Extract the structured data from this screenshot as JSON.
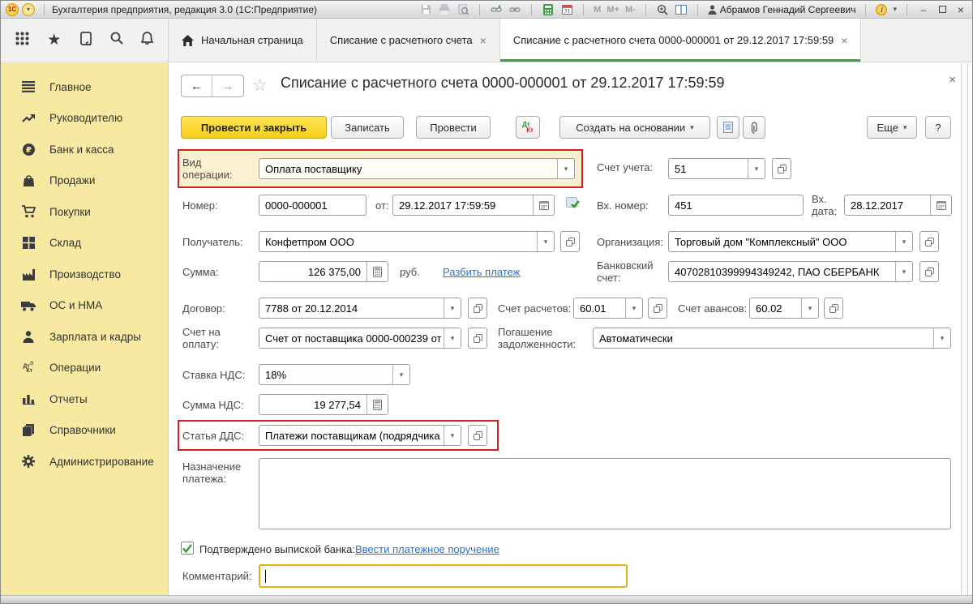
{
  "titlebar": {
    "logo_text": "1С",
    "app_title": "Бухгалтерия предприятия, редакция 3.0  (1С:Предприятие)",
    "user_name": "Абрамов Геннадий Сергеевич",
    "mem": [
      "M",
      "M+",
      "M-"
    ]
  },
  "icons": {
    "dropdown": "▾",
    "close": "×",
    "back_arrow": "←",
    "forward_arrow": "→",
    "star_outline": "☆",
    "help": "?",
    "minimize": "–",
    "info_letter": "i",
    "calendar_day": "31",
    "dt": "Дт",
    "kt": "Кт"
  },
  "tabbar": {
    "tabs": [
      {
        "label": "Начальная страница"
      },
      {
        "label": "Списание с расчетного счета"
      },
      {
        "label": "Списание с расчетного счета 0000-000001 от 29.12.2017 17:59:59"
      }
    ]
  },
  "sidebar": {
    "items": [
      {
        "label": "Главное"
      },
      {
        "label": "Руководителю"
      },
      {
        "label": "Банк и касса"
      },
      {
        "label": "Продажи"
      },
      {
        "label": "Покупки"
      },
      {
        "label": "Склад"
      },
      {
        "label": "Производство"
      },
      {
        "label": "ОС и НМА"
      },
      {
        "label": "Зарплата и кадры"
      },
      {
        "label": "Операции"
      },
      {
        "label": "Отчеты"
      },
      {
        "label": "Справочники"
      },
      {
        "label": "Администрирование"
      }
    ]
  },
  "form": {
    "title": "Списание с расчетного счета 0000-000001 от 29.12.2017 17:59:59",
    "toolbar": {
      "post_and_close": "Провести и закрыть",
      "save": "Записать",
      "post": "Провести",
      "create_based": "Создать на основании",
      "more": "Еще"
    },
    "fields": {
      "vid_operacii": {
        "label": "Вид операции:",
        "value": "Оплата поставщику"
      },
      "schet_ucheta": {
        "label": "Счет учета:",
        "value": "51"
      },
      "nomer": {
        "label": "Номер:",
        "value": "0000-000001"
      },
      "ot": {
        "label": "от:",
        "value": "29.12.2017 17:59:59"
      },
      "vh_nomer": {
        "label": "Вх. номер:",
        "value": "451"
      },
      "vh_data": {
        "label": "Вх. дата:",
        "value": "28.12.2017"
      },
      "poluchatel": {
        "label": "Получатель:",
        "value": "Конфетпром ООО"
      },
      "organizaciya": {
        "label": "Организация:",
        "value": "Торговый дом \"Комплексный\" ООО"
      },
      "summa": {
        "label": "Сумма:",
        "value": "126 375,00",
        "currency": "руб.",
        "split_link": "Разбить платеж"
      },
      "bank_schet": {
        "label": "Банковский счет:",
        "value": "40702810399994349242, ПАО СБЕРБАНК"
      },
      "dogovor": {
        "label": "Договор:",
        "value": "7788 от 20.12.2014"
      },
      "schet_raschetov": {
        "label": "Счет расчетов:",
        "value": "60.01"
      },
      "schet_avansov": {
        "label": "Счет авансов:",
        "value": "60.02"
      },
      "schet_na_oplatu": {
        "label": "Счет на оплату:",
        "value": "Счет от поставщика 0000-000239 от"
      },
      "pogashenie": {
        "label": "Погашение задолженности:",
        "value": "Автоматически"
      },
      "stavka_nds": {
        "label": "Ставка НДС:",
        "value": "18%"
      },
      "summa_nds": {
        "label": "Сумма НДС:",
        "value": "19 277,54"
      },
      "statya_dds": {
        "label": "Статья ДДС:",
        "value": "Платежи поставщикам (подрядчика"
      },
      "naznachenie": {
        "label": "Назначение платежа:",
        "value": ""
      },
      "kommentarij": {
        "label": "Комментарий:",
        "value": ""
      }
    },
    "confirm": {
      "checkbox_label": "Подтверждено выпиской банка:",
      "link_label": "Ввести платежное поручение"
    }
  }
}
